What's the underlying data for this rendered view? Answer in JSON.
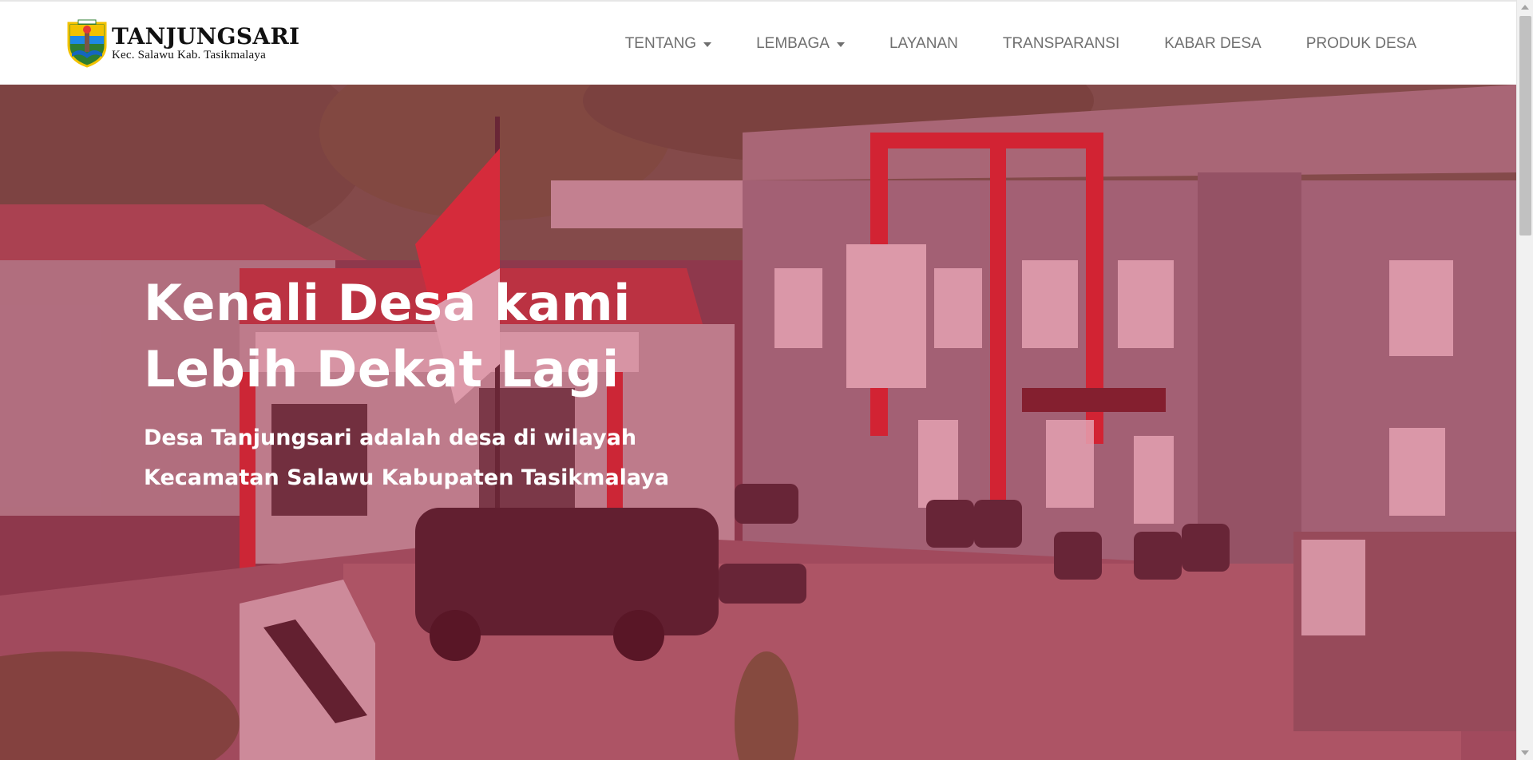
{
  "brand": {
    "title": "TANJUNGSARI",
    "subtitle": "Kec. Salawu Kab. Tasikmalaya",
    "logo_icon": "village-emblem-icon"
  },
  "nav": {
    "items": [
      {
        "label": "TENTANG",
        "has_dropdown": true
      },
      {
        "label": "LEMBAGA",
        "has_dropdown": true
      },
      {
        "label": "LAYANAN",
        "has_dropdown": false
      },
      {
        "label": "TRANSPARANSI",
        "has_dropdown": false
      },
      {
        "label": "KABAR DESA",
        "has_dropdown": false
      },
      {
        "label": "PRODUK DESA",
        "has_dropdown": false
      }
    ]
  },
  "hero": {
    "title_line1": "Kenali Desa kami",
    "title_line2": "Lebih Dekat Lagi",
    "desc_line1": "Desa Tanjungsari adalah desa di wilayah",
    "desc_line2": "Kecamatan Salawu Kabupaten Tasikmalaya",
    "overlay_color": "#be1e46"
  },
  "colors": {
    "nav_text": "#6f6f6f",
    "brand_text": "#111111",
    "hero_text": "#ffffff"
  }
}
